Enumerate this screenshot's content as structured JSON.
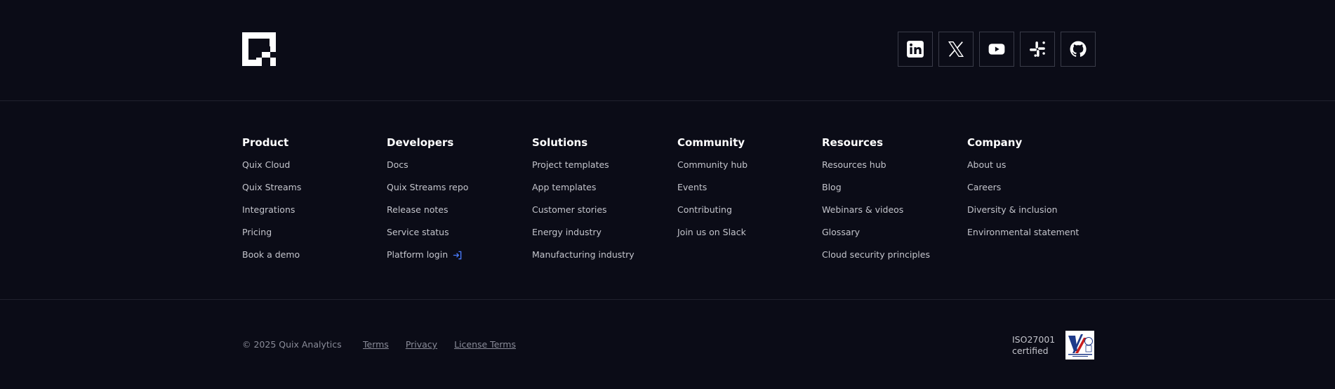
{
  "social": {
    "items": [
      {
        "name": "linkedin",
        "icon": "linkedin-icon"
      },
      {
        "name": "x",
        "icon": "x-icon"
      },
      {
        "name": "youtube",
        "icon": "youtube-icon"
      },
      {
        "name": "slack",
        "icon": "slack-icon"
      },
      {
        "name": "github",
        "icon": "github-icon"
      }
    ]
  },
  "columns": [
    {
      "title": "Product",
      "links": [
        "Quix Cloud",
        "Quix Streams",
        "Integrations",
        "Pricing",
        "Book a demo"
      ]
    },
    {
      "title": "Developers",
      "links": [
        "Docs",
        "Quix Streams repo",
        "Release notes",
        "Service status",
        "Platform login"
      ]
    },
    {
      "title": "Solutions",
      "links": [
        "Project templates",
        "App templates",
        "Customer stories",
        "Energy industry",
        "Manufacturing industry"
      ]
    },
    {
      "title": "Community",
      "links": [
        "Community hub",
        "Events",
        "Contributing",
        "Join us on Slack"
      ]
    },
    {
      "title": "Resources",
      "links": [
        "Resources hub",
        "Blog",
        "Webinars & videos",
        "Glossary",
        "Cloud security principles"
      ]
    },
    {
      "title": "Company",
      "links": [
        "About us",
        "Careers",
        "Diversity & inclusion",
        "Environmental statement"
      ]
    }
  ],
  "bottom": {
    "copyright": "© 2025 Quix Analytics",
    "legal": [
      "Terms",
      "Privacy",
      "License Terms"
    ],
    "iso_line1": "ISO27001",
    "iso_line2": "certified"
  },
  "colors": {
    "background": "#0b0c17",
    "link": "#c4c5cc",
    "muted": "#8a8c99",
    "accent": "#4a7cff"
  }
}
